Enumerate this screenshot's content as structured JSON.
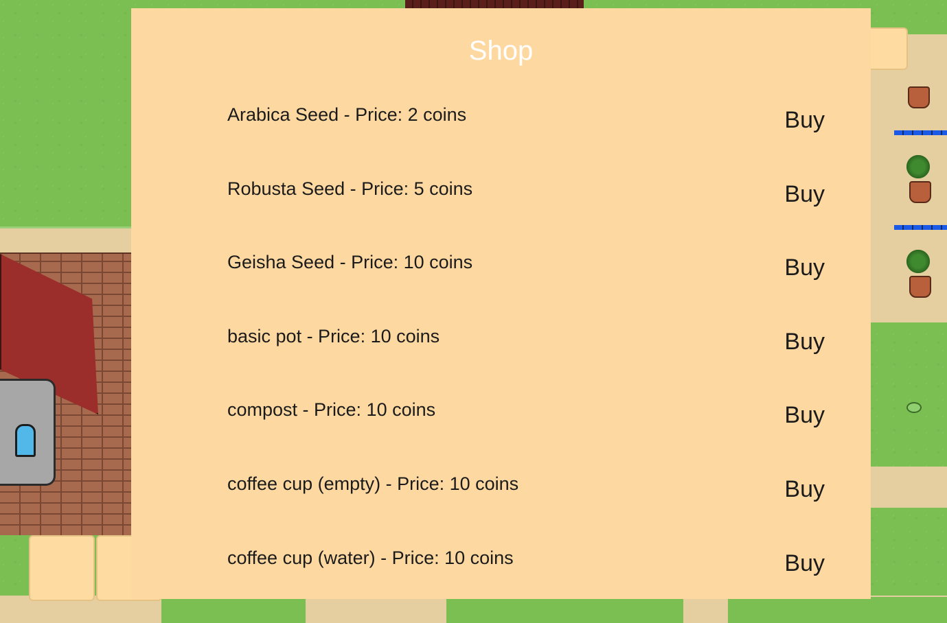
{
  "shop": {
    "title": "Shop",
    "items": [
      {
        "label": "Arabica Seed - Price: 2 coins",
        "buy_label": "Buy"
      },
      {
        "label": "Robusta Seed - Price: 5 coins",
        "buy_label": "Buy"
      },
      {
        "label": "Geisha Seed - Price: 10 coins",
        "buy_label": "Buy"
      },
      {
        "label": "basic pot - Price: 10 coins",
        "buy_label": "Buy"
      },
      {
        "label": "compost - Price: 10 coins",
        "buy_label": "Buy"
      },
      {
        "label": "coffee cup (empty) - Price: 10 coins",
        "buy_label": "Buy"
      },
      {
        "label": "coffee cup (water) - Price: 10 coins",
        "buy_label": "Buy"
      }
    ]
  },
  "colors": {
    "panel": "#fed8a1",
    "grass": "#7bbf52",
    "path": "#e5cfa0",
    "title_text": "#ffffff",
    "item_text": "#1b1b1b"
  }
}
